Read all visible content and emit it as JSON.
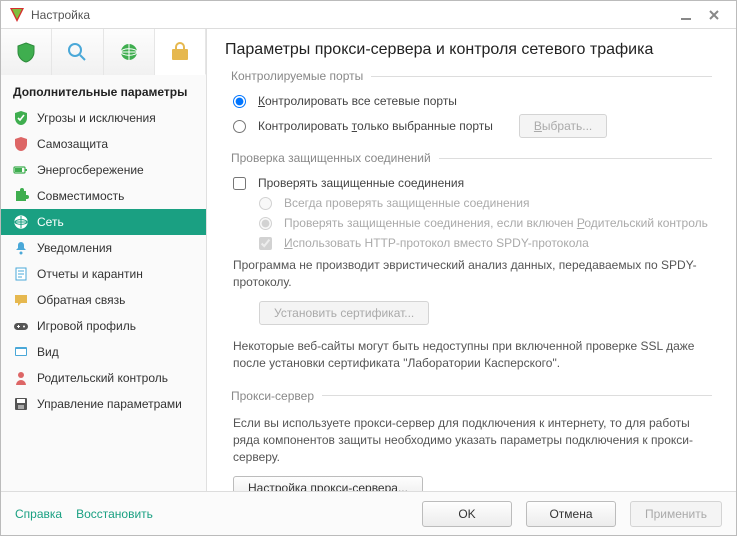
{
  "window": {
    "title": "Настройка"
  },
  "tabs": [
    "protection",
    "scan",
    "update",
    "advanced"
  ],
  "sidebar": {
    "heading": "Дополнительные параметры",
    "items": [
      {
        "label": "Угрозы и исключения",
        "icon": "shield-check-icon"
      },
      {
        "label": "Самозащита",
        "icon": "shield-icon"
      },
      {
        "label": "Энергосбережение",
        "icon": "battery-icon"
      },
      {
        "label": "Совместимость",
        "icon": "puzzle-icon"
      },
      {
        "label": "Сеть",
        "icon": "globe-icon"
      },
      {
        "label": "Уведомления",
        "icon": "bell-icon"
      },
      {
        "label": "Отчеты и карантин",
        "icon": "report-icon"
      },
      {
        "label": "Обратная связь",
        "icon": "feedback-icon"
      },
      {
        "label": "Игровой профиль",
        "icon": "gamepad-icon"
      },
      {
        "label": "Вид",
        "icon": "view-icon"
      },
      {
        "label": "Родительский контроль",
        "icon": "parental-icon"
      },
      {
        "label": "Управление параметрами",
        "icon": "save-icon"
      }
    ],
    "active_index": 4
  },
  "main": {
    "title": "Параметры прокси-сервера и контроля сетевого трафика",
    "ports": {
      "group_title": "Контролируемые порты",
      "opt_all_prefix": "К",
      "opt_all_rest": "онтролировать все сетевые порты",
      "opt_selected_prefix": "Контролировать ",
      "opt_selected_u": "т",
      "opt_selected_rest": "олько выбранные порты",
      "select_btn_prefix": "В",
      "select_btn_rest": "ыбрать..."
    },
    "ssl": {
      "group_title": "Проверка защищенных соединений",
      "chk_label": "Проверять защищенные соединения",
      "opt_always": "Всегда проверять защищенные соединения",
      "opt_parental_prefix": "Проверять защищенные соединения, если включен ",
      "opt_parental_u": "Р",
      "opt_parental_rest": "одительский контроль",
      "chk_http_prefix": "И",
      "chk_http_rest": "спользовать HTTP-протокол вместо SPDY-протокола",
      "spdy_note": "Программа не производит эвристический анализ данных, передаваемых по SPDY-протоколу.",
      "install_cert_btn": "Установить сертификат...",
      "ssl_warning": "Некоторые веб-сайты могут быть недоступны при включенной проверке SSL даже после установки сертификата \"Лаборатории Касперского\"."
    },
    "proxy": {
      "group_title": "Прокси-сервер",
      "note": "Если вы используете прокси-сервер для подключения к интернету, то для работы ряда компонентов защиты необходимо указать параметры подключения к прокси-серверу.",
      "btn_prefix": "Н",
      "btn_rest": "астройка прокси-сервера..."
    }
  },
  "footer": {
    "help": "Справка",
    "restore": "Восстановить",
    "ok": "OK",
    "cancel": "Отмена",
    "apply": "Применить"
  }
}
